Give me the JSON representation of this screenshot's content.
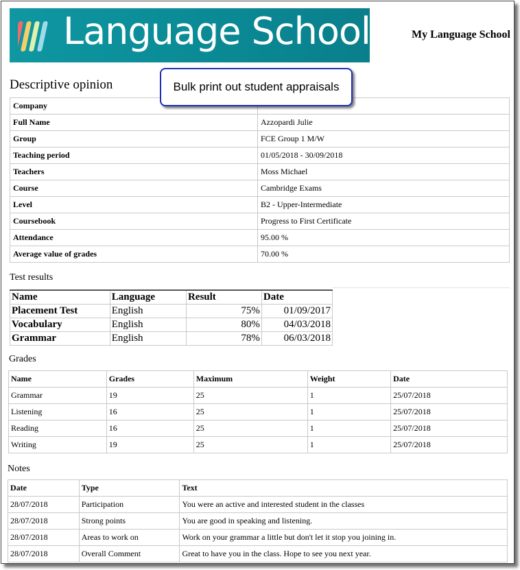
{
  "header": {
    "logo_text": "Language School",
    "school_name": "My Language School",
    "stripe_colors": [
      "#f26b6b",
      "#f3cf6a",
      "#dff1b0",
      "#9fdbe6"
    ]
  },
  "callout": {
    "text": "Bulk print out student appraisals"
  },
  "descriptive": {
    "heading": "Descriptive opinion",
    "rows": [
      {
        "label": "Company",
        "value": ""
      },
      {
        "label": "Full Name",
        "value": "Azzopardi Julie"
      },
      {
        "label": "Group",
        "value": "FCE Group 1 M/W"
      },
      {
        "label": "Teaching period",
        "value": "01/05/2018 - 30/09/2018"
      },
      {
        "label": "Teachers",
        "value": "Moss Michael"
      },
      {
        "label": "Course",
        "value": "Cambridge Exams"
      },
      {
        "label": "Level",
        "value": "B2 - Upper-Intermediate"
      },
      {
        "label": "Coursebook",
        "value": "Progress to First Certificate"
      },
      {
        "label": "Attendance",
        "value": "95.00 %"
      },
      {
        "label": "Average value of grades",
        "value": "70.00 %"
      }
    ]
  },
  "tests": {
    "heading": "Test results",
    "columns": [
      "Name",
      "Language",
      "Result",
      "Date"
    ],
    "rows": [
      [
        "Placement Test",
        "English",
        "75%",
        "01/09/2017"
      ],
      [
        "Vocabulary",
        "English",
        "80%",
        "04/03/2018"
      ],
      [
        "Grammar",
        "English",
        "78%",
        "06/03/2018"
      ]
    ]
  },
  "grades": {
    "heading": "Grades",
    "columns": [
      "Name",
      "Grades",
      "Maximum",
      "Weight",
      "Date"
    ],
    "rows": [
      [
        "Grammar",
        "19",
        "25",
        "1",
        "25/07/2018"
      ],
      [
        "Listening",
        "16",
        "25",
        "1",
        "25/07/2018"
      ],
      [
        "Reading",
        "16",
        "25",
        "1",
        "25/07/2018"
      ],
      [
        "Writing",
        "19",
        "25",
        "1",
        "25/07/2018"
      ]
    ]
  },
  "notes": {
    "heading": "Notes",
    "columns": [
      "Date",
      "Type",
      "Text"
    ],
    "rows": [
      [
        "28/07/2018",
        "Participation",
        "You were an active and interested student in the classes"
      ],
      [
        "28/07/2018",
        "Strong points",
        "You are good in speaking and listening."
      ],
      [
        "28/07/2018",
        "Areas to work on",
        "Work on your grammar a little but don't let it stop you joining in."
      ],
      [
        "28/07/2018",
        "Overall Comment",
        "Great to have you in the class. Hope to see you next year."
      ]
    ]
  }
}
